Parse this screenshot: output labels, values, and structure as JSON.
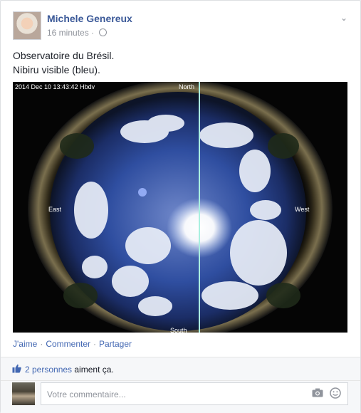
{
  "post": {
    "author": "Michele Genereux",
    "timestamp": "16 minutes",
    "privacy_icon": "globe-icon",
    "text_line1": "Observatoire du Brésil.",
    "text_line2": "Nibiru visible (bleu).",
    "menu_icon": "chevron-down-icon"
  },
  "photo": {
    "stamp": "2014 Dec 10  13:43:42 Hbdv",
    "north": "North",
    "south": "South",
    "east": "East",
    "west": "West"
  },
  "actions": {
    "like": "J'aime",
    "comment": "Commenter",
    "share": "Partager",
    "separator": "·"
  },
  "likes": {
    "count_text": "2 personnes",
    "suffix": " aiment ça."
  },
  "comment_box": {
    "placeholder": "Votre commentaire...",
    "camera_icon": "camera-icon",
    "emoji_icon": "smiley-icon"
  }
}
